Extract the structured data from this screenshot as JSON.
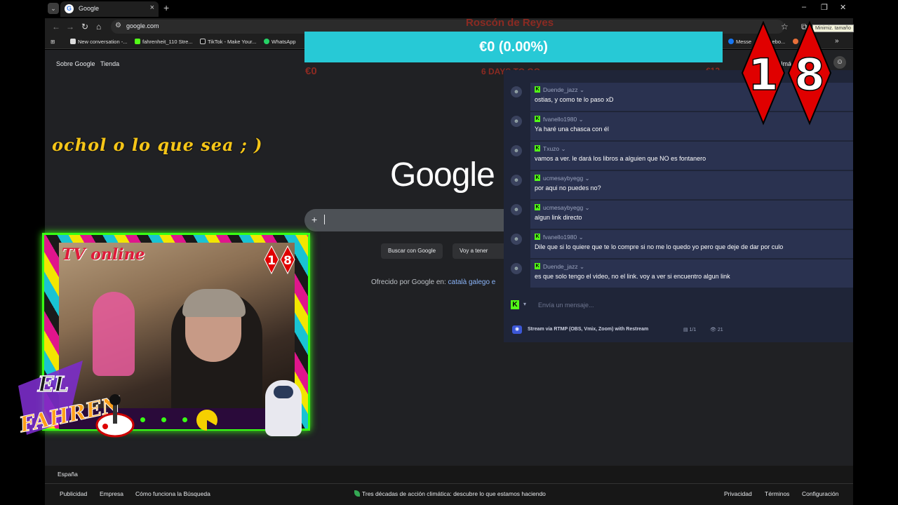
{
  "browser": {
    "tab_title": "Google",
    "url": "google.com",
    "tooltip": "Minimiz. tamaño",
    "bookmarks": [
      "New conversation -...",
      "fahrenheit_110 Stre...",
      "TikTok - Make Your...",
      "WhatsApp",
      "Messe",
      "rebo..."
    ]
  },
  "google": {
    "top_links": [
      "Sobre Google",
      "Tienda"
    ],
    "top_right_partial": "Imá",
    "logo": "Google",
    "buttons": [
      "Buscar con Google",
      "Voy a tener suer"
    ],
    "offered_prefix": "Ofrecido por Google en:",
    "offered_langs": "català galego e",
    "country": "España",
    "footer_left": [
      "Publicidad",
      "Empresa",
      "Cómo funciona la Búsqueda"
    ],
    "footer_center": "Tres décadas de acción climática: descubre lo que estamos haciendo",
    "footer_right": [
      "Privacidad",
      "Términos",
      "Configuración"
    ]
  },
  "overlay": {
    "scroll_text": "ochol o lo que sea ; )",
    "goal": {
      "title": "Roscón de Reyes",
      "amount": "€0 (0.00%)",
      "progress_percent": 0,
      "min": "€0",
      "days_left": "6 DAYS TO GO",
      "max": "€12"
    },
    "age_rating": [
      "1",
      "8"
    ],
    "cam_label": "TV online",
    "cam_badge": [
      "1",
      "8"
    ],
    "brand_line1": "EL",
    "brand_line2": "FAHREN"
  },
  "chat": {
    "messages": [
      {
        "user": "Duende_jazz",
        "text": "ostias, y como te lo paso xD"
      },
      {
        "user": "fvanello1980",
        "text": "Ya haré una chasca con él"
      },
      {
        "user": "Txuzo",
        "text": "vamos a ver. le dará los libros a alguien que NO es fontanero"
      },
      {
        "user": "ucmesaybyegg",
        "text": "por aqui no puedes no?"
      },
      {
        "user": "ucmesaybyegg",
        "text": "algun link directo"
      },
      {
        "user": "fvanello1980",
        "text": "Dile que si lo quiere que te lo compre si no me lo quedo yo pero que deje de dar por culo"
      },
      {
        "user": "Duende_jazz",
        "text": "es que solo tengo el video, no el link. voy a ver si encuentro algun link"
      }
    ],
    "input_placeholder": "Envía un mensaje...",
    "stream_label": "Stream via RTMP (OBS, Vmix, Zoom) with Restream",
    "scenes": "1/1",
    "viewers": "21"
  }
}
